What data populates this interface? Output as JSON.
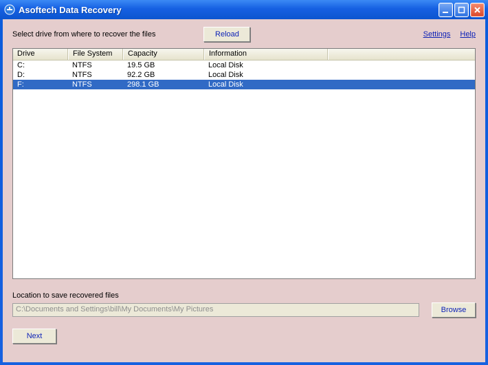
{
  "window": {
    "title": "Asoftech Data Recovery"
  },
  "top": {
    "prompt": "Select drive from where to recover the files",
    "reload_label": "Reload",
    "settings_label": "Settings",
    "help_label": "Help"
  },
  "list": {
    "headers": {
      "drive": "Drive",
      "fs": "File System",
      "cap": "Capacity",
      "info": "Information"
    },
    "rows": [
      {
        "drive": "C:",
        "fs": "NTFS",
        "cap": "19.5 GB",
        "info": "Local Disk",
        "selected": false
      },
      {
        "drive": "D:",
        "fs": "NTFS",
        "cap": "92.2 GB",
        "info": "Local Disk",
        "selected": false
      },
      {
        "drive": "F:",
        "fs": "NTFS",
        "cap": "298.1 GB",
        "info": "Local Disk",
        "selected": true
      }
    ]
  },
  "save": {
    "label": "Location to save recovered files",
    "path": "C:\\Documents and Settings\\bill\\My Documents\\My Pictures",
    "browse_label": "Browse"
  },
  "footer": {
    "next_label": "Next"
  }
}
